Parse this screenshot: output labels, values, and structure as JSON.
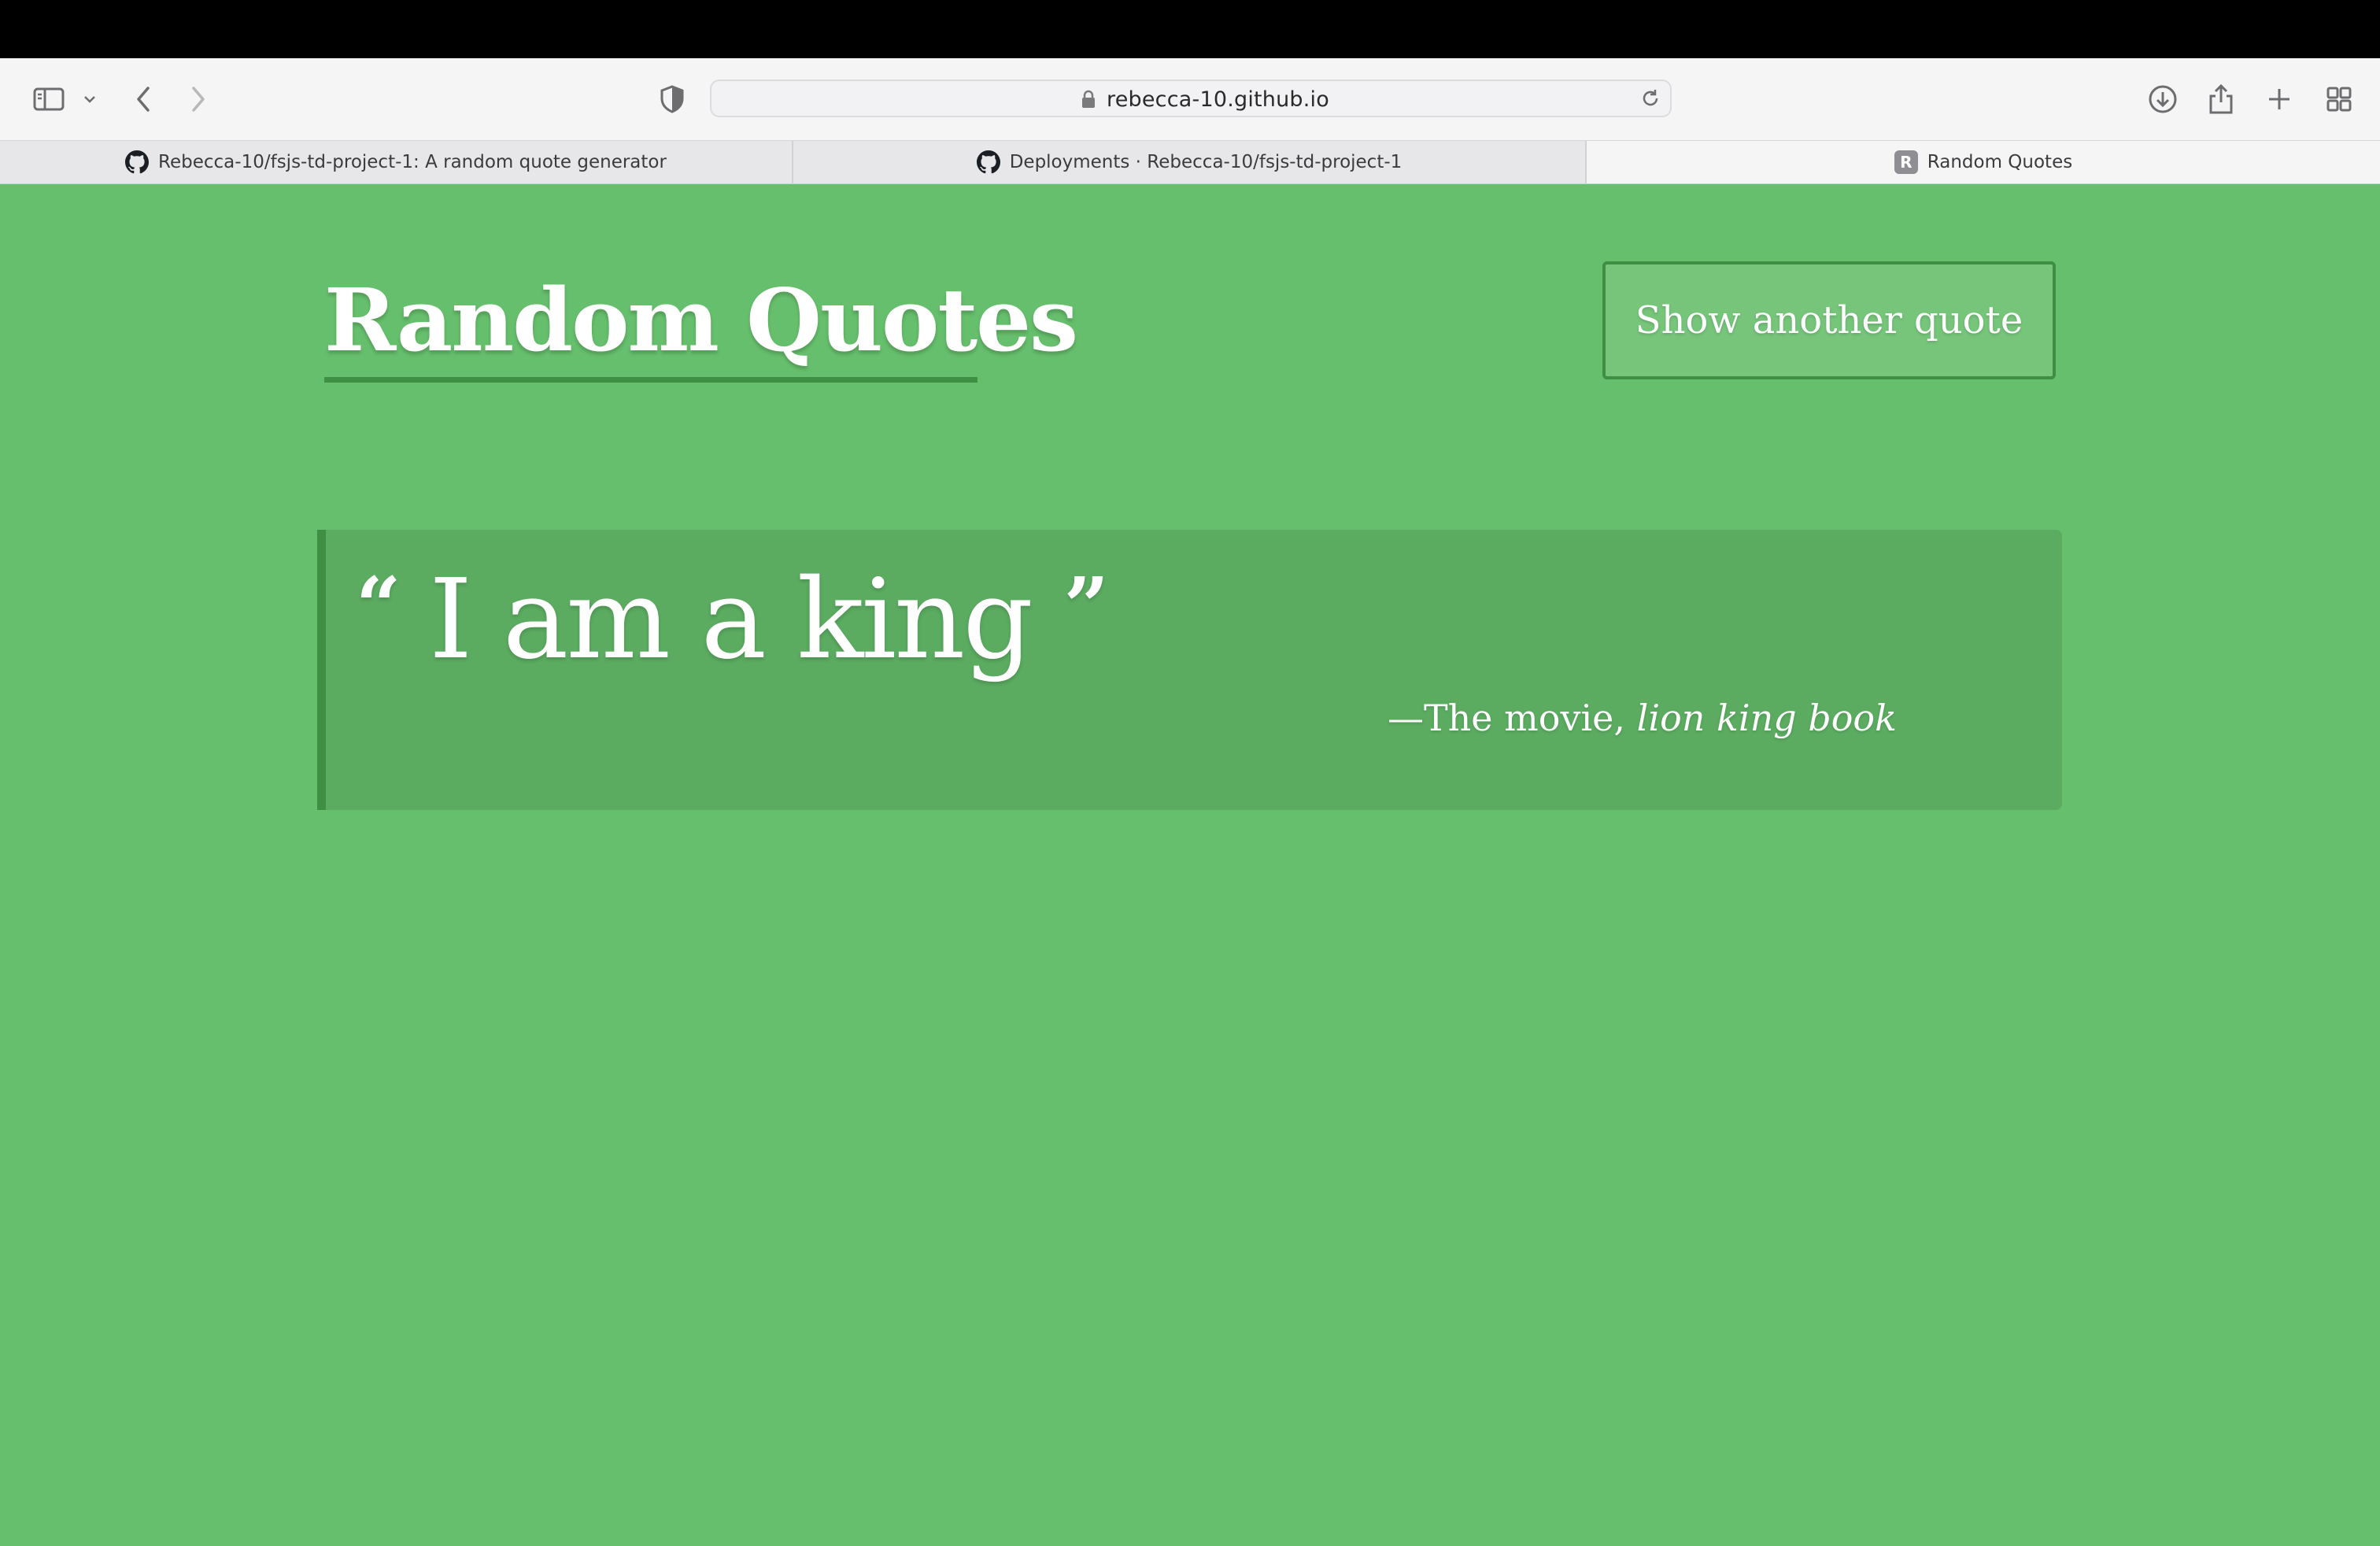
{
  "browser": {
    "address": "rebecca-10.github.io",
    "tabs": [
      {
        "label": "Rebecca-10/fsjs-td-project-1: A random quote generator",
        "icon": "github-icon"
      },
      {
        "label": "Deployments · Rebecca-10/fsjs-td-project-1",
        "icon": "github-icon"
      },
      {
        "label": "Random Quotes",
        "icon": "r-favicon",
        "favicon_letter": "R",
        "active": true
      }
    ]
  },
  "page": {
    "title": "Random Quotes",
    "button_label": "Show another quote",
    "quote": {
      "open_mark": "“",
      "text": "I am a king",
      "close_mark": "”",
      "source": "—The movie, ",
      "citation": "lion king book"
    },
    "colors": {
      "background": "#66bf6c",
      "accent": "#3e8e44",
      "quote_box": "#5bab61",
      "button": "#76c57b"
    }
  }
}
